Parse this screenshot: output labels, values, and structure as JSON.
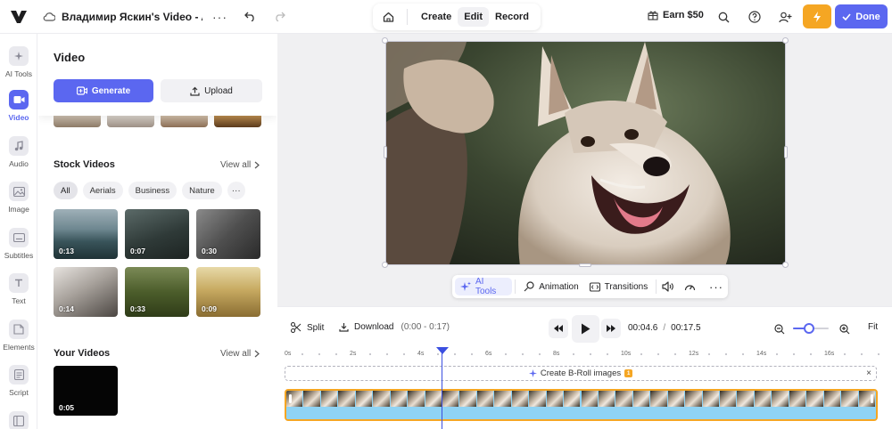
{
  "topbar": {
    "project_title": "Владимир Яскин's Video - A...",
    "modes": [
      "Create",
      "Edit",
      "Record"
    ],
    "active_mode": "Edit",
    "earn_label": "Earn $50",
    "done_label": "Done"
  },
  "rail": {
    "items": [
      {
        "label": "AI Tools",
        "icon": "sparkle-icon"
      },
      {
        "label": "Video",
        "icon": "video-camera-icon",
        "active": true
      },
      {
        "label": "Audio",
        "icon": "music-note-icon"
      },
      {
        "label": "Image",
        "icon": "image-icon"
      },
      {
        "label": "Subtitles",
        "icon": "subtitles-icon"
      },
      {
        "label": "Text",
        "icon": "text-icon"
      },
      {
        "label": "Elements",
        "icon": "elements-icon"
      },
      {
        "label": "Script",
        "icon": "script-icon"
      }
    ]
  },
  "panel": {
    "title": "Video",
    "generate_label": "Generate",
    "upload_label": "Upload",
    "stock": {
      "title": "Stock Videos",
      "view_all": "View all",
      "chips": [
        "All",
        "Aerials",
        "Business",
        "Nature"
      ],
      "active_chip": "All",
      "thumbs": [
        {
          "duration": "0:13"
        },
        {
          "duration": "0:07"
        },
        {
          "duration": "0:30"
        },
        {
          "duration": "0:14"
        },
        {
          "duration": "0:33"
        },
        {
          "duration": "0:09"
        }
      ]
    },
    "yours": {
      "title": "Your Videos",
      "view_all": "View all",
      "thumbs": [
        {
          "duration": "0:05"
        }
      ]
    }
  },
  "edit_toolbar": {
    "ai_tools": "AI Tools",
    "animation": "Animation",
    "transitions": "Transitions"
  },
  "timeline": {
    "split_label": "Split",
    "download_label": "Download",
    "download_range": "(0:00 - 0:17)",
    "current_time": "00:04.6",
    "separator": "/",
    "total_time": "00:17.5",
    "fit_label": "Fit",
    "zoom_level": 0.45,
    "ruler_labels": [
      "0s",
      "2s",
      "4s",
      "6s",
      "8s",
      "10s",
      "12s",
      "14s",
      "16s"
    ],
    "broll_label": "Create B-Roll images",
    "broll_badge": "1",
    "close_label": "×"
  },
  "colors": {
    "accent": "#5b67f0",
    "warning": "#f5a623",
    "track_audio": "#8fd3f4"
  }
}
